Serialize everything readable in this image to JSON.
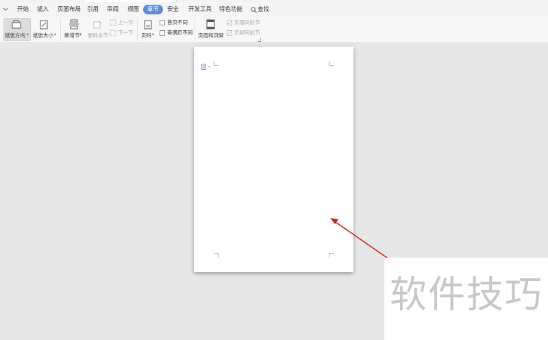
{
  "menu": {
    "items": [
      "开始",
      "插入",
      "页面布局",
      "引用",
      "审阅",
      "视图",
      "章节",
      "安全",
      "开发工具",
      "特色功能"
    ],
    "active": "章节",
    "search_label": "查找"
  },
  "ribbon": {
    "orientation_label": "纸张方向",
    "size_label": "纸张大小",
    "new_section_label": "新增节",
    "delete_section_label": "删除本节",
    "prev_section_label": "上一节",
    "next_section_label": "下一节",
    "page_number_label": "页码",
    "first_page_diff_label": "首页不同",
    "odd_even_diff_label": "奇偶页不同",
    "header_footer_label": "页眉和页脚",
    "header_same_label": "页眉同前节",
    "footer_same_label": "页脚同前节"
  },
  "watermark": {
    "text": "软件技巧"
  },
  "colors": {
    "accent": "#5b8cd6",
    "arrow": "#cc1f1f",
    "workspace": "#e7e7e7"
  }
}
